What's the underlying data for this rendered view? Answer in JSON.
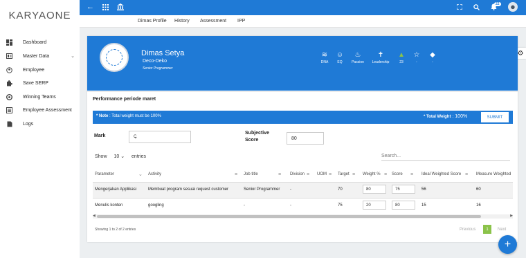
{
  "app": {
    "logo_text": "KARYAONE"
  },
  "topbar": {
    "notification_count": "22"
  },
  "subnav": {
    "tabs": [
      "Dimas Profile",
      "History",
      "Assessment",
      "IPP"
    ]
  },
  "sidebar": {
    "items": [
      {
        "label": "Dashboard",
        "icon": "dashboard-icon"
      },
      {
        "label": "Master Data",
        "icon": "master-data-icon"
      },
      {
        "label": "Employee",
        "icon": "employee-icon"
      },
      {
        "label": "Save SERP",
        "icon": "puzzle-icon"
      },
      {
        "label": "Winning Teams",
        "icon": "winning-teams-icon"
      },
      {
        "label": "Employee Assessment",
        "icon": "list-icon"
      },
      {
        "label": "Logs",
        "icon": "file-icon"
      }
    ]
  },
  "profile": {
    "name": "Dimas Setya",
    "company": "Deco-Deko",
    "role": "Senior Programmer",
    "stats": [
      {
        "label": "DNA",
        "icon": "dna-icon"
      },
      {
        "label": "EQ",
        "icon": "smile-icon"
      },
      {
        "label": "Passion",
        "icon": "flame-icon"
      },
      {
        "label": "Leadership",
        "icon": "person-icon"
      },
      {
        "label": "23",
        "icon": "thumbs-up-icon"
      },
      {
        "label": "-",
        "icon": "star-icon"
      },
      {
        "label": "-",
        "icon": "tag-icon"
      }
    ]
  },
  "performance": {
    "title": "Performance periode maret",
    "note_bold": "* Note",
    "note_text": " : Total weight must be 100%",
    "total_weight_label": "* Total Weight",
    "total_weight_value": " : 100%",
    "submit_label": "SUBMIT",
    "mark_label": "Mark",
    "mark_value": "C",
    "subjective_label_1": "Subjective",
    "subjective_label_2": "Score",
    "subjective_value": "80",
    "show_label": "Show",
    "show_value": "10",
    "entries_label": "entries",
    "search_placeholder": "Search..."
  },
  "table": {
    "columns": [
      "Parameter",
      "Activity",
      "Job title",
      "Division",
      "UOM",
      "Target",
      "Weight %",
      "Score",
      "Ideal Weighted Score",
      "Measure Weighted"
    ],
    "rows": [
      [
        "Mengerjakan Applikasi",
        "Membuat program sesuai request customer",
        "Senior Programmer",
        "-",
        "",
        "70",
        "80",
        "75",
        "56",
        "60"
      ],
      [
        "Menulis konten",
        "googling",
        "-",
        "-",
        "",
        "75",
        "20",
        "80",
        "15",
        "16"
      ]
    ]
  },
  "footer": {
    "info": "Showing 1 to 2 of 2 entries",
    "previous": "Previous",
    "page": "1",
    "next": "Next"
  }
}
